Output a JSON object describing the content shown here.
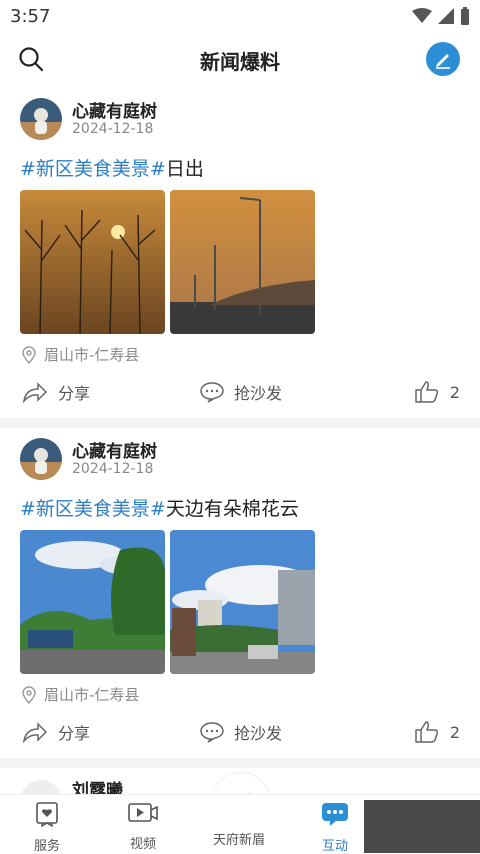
{
  "status": {
    "time": "3:57"
  },
  "header": {
    "title": "新闻爆料"
  },
  "posts": [
    {
      "username": "心藏有庭树",
      "date": "2024-12-18",
      "tag": "#新区美食美景#",
      "text": "日出",
      "location": "眉山市-仁寿县",
      "actions": {
        "share": "分享",
        "comment": "抢沙发",
        "likes": "2"
      }
    },
    {
      "username": "心藏有庭树",
      "date": "2024-12-18",
      "tag": "#新区美食美景#",
      "text": "天边有朵棉花云",
      "location": "眉山市-仁寿县",
      "actions": {
        "share": "分享",
        "comment": "抢沙发",
        "likes": "2"
      }
    },
    {
      "username": "刘露曦"
    }
  ],
  "tabbar": {
    "items": [
      {
        "label": "服务"
      },
      {
        "label": "视频"
      },
      {
        "label": "天府新眉"
      },
      {
        "label": "互动"
      }
    ]
  },
  "colors": {
    "accent": "#2c8fd6",
    "tag": "#2c7fc7"
  }
}
